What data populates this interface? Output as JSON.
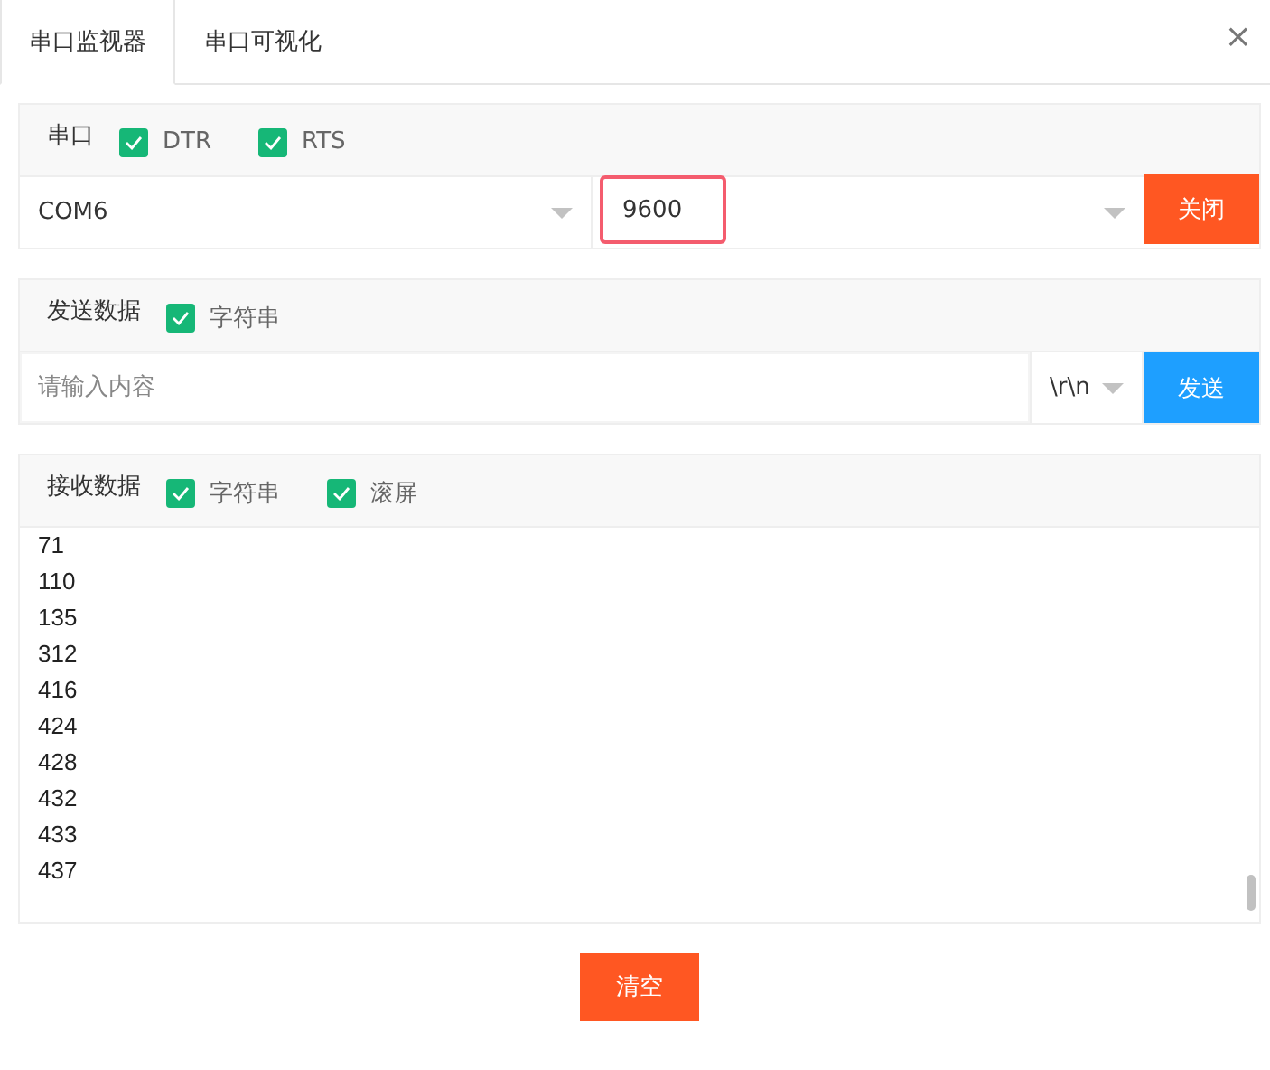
{
  "tabs": [
    {
      "label": "串口监视器",
      "selected": true
    },
    {
      "label": "串口可视化",
      "selected": false
    }
  ],
  "close": "×",
  "port_panel": {
    "title": "串口",
    "options": [
      {
        "label": "DTR",
        "checked": true
      },
      {
        "label": "RTS",
        "checked": true
      }
    ],
    "port": "COM6",
    "baud": "9600",
    "button": "关闭"
  },
  "send_panel": {
    "title": "发送数据",
    "options": [
      {
        "label": "字符串",
        "checked": true
      }
    ],
    "placeholder": "请输入内容",
    "line_ending": "\\r\\n",
    "button": "发送"
  },
  "receive_panel": {
    "title": "接收数据",
    "options": [
      {
        "label": "字符串",
        "checked": true
      },
      {
        "label": "滚屏",
        "checked": true
      }
    ],
    "lines": [
      "71",
      "110",
      "135",
      "312",
      "416",
      "424",
      "428",
      "432",
      "433",
      "437"
    ]
  },
  "clear_button": "清空"
}
